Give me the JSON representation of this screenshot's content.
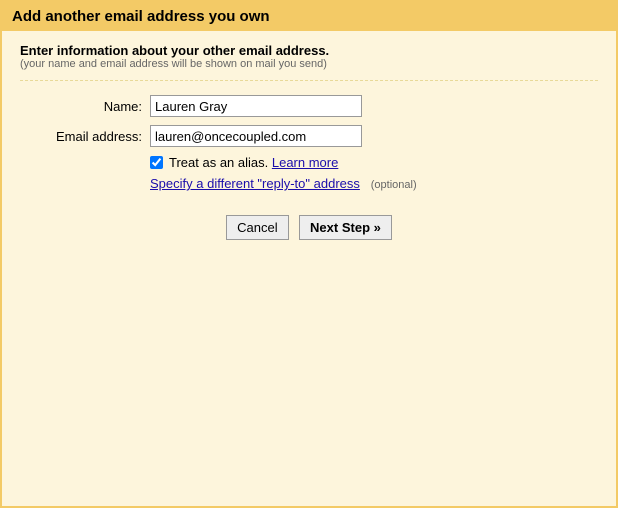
{
  "header": {
    "title": "Add another email address you own"
  },
  "content": {
    "subtitle": "Enter information about your other email address.",
    "subtitle_note": "(your name and email address will be shown on mail you send)"
  },
  "form": {
    "name_label": "Name:",
    "name_value": "Lauren Gray",
    "email_label": "Email address:",
    "email_value": "lauren@oncecoupled.com",
    "alias_label": "Treat as an alias.",
    "alias_checked": true,
    "learn_more": "Learn more",
    "reply_to_link": "Specify a different \"reply-to\" address",
    "optional_text": "(optional)"
  },
  "buttons": {
    "cancel": "Cancel",
    "next": "Next Step »"
  }
}
